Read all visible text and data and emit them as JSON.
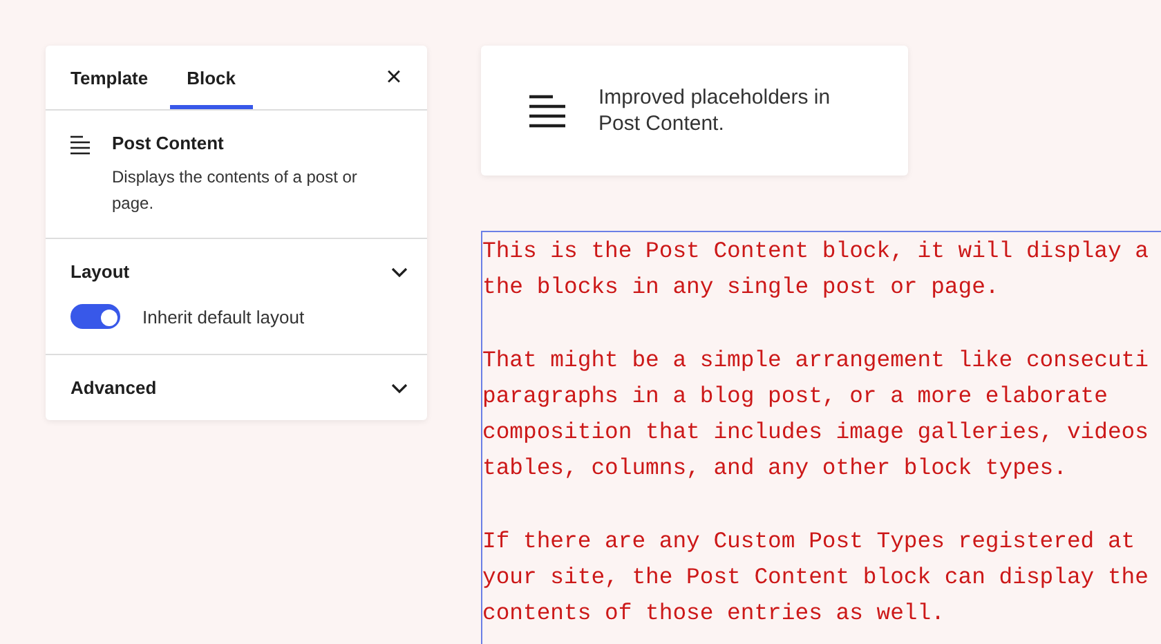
{
  "sidebar": {
    "tabs": [
      {
        "label": "Template",
        "selected": false
      },
      {
        "label": "Block",
        "selected": true
      }
    ],
    "close": "×",
    "block": {
      "title": "Post Content",
      "description": "Displays the contents of a post or page."
    },
    "panels": [
      {
        "title": "Layout",
        "toggle": {
          "label": "Inherit default layout",
          "on": true
        }
      },
      {
        "title": "Advanced"
      }
    ]
  },
  "note": {
    "text": "Improved placeholders in Post Content."
  },
  "preview": {
    "paragraphs": [
      [
        "This is the Post Content block, it will display a",
        "the blocks in any single post or page."
      ],
      [
        "That might be a simple arrangement like consecuti",
        "paragraphs in a blog post, or a more elaborate",
        "composition that includes image galleries, videos",
        "tables, columns, and any other block types."
      ],
      [
        "If there are any Custom Post Types registered at",
        "your site, the Post Content block can display the",
        "contents of those entries as well."
      ]
    ]
  }
}
